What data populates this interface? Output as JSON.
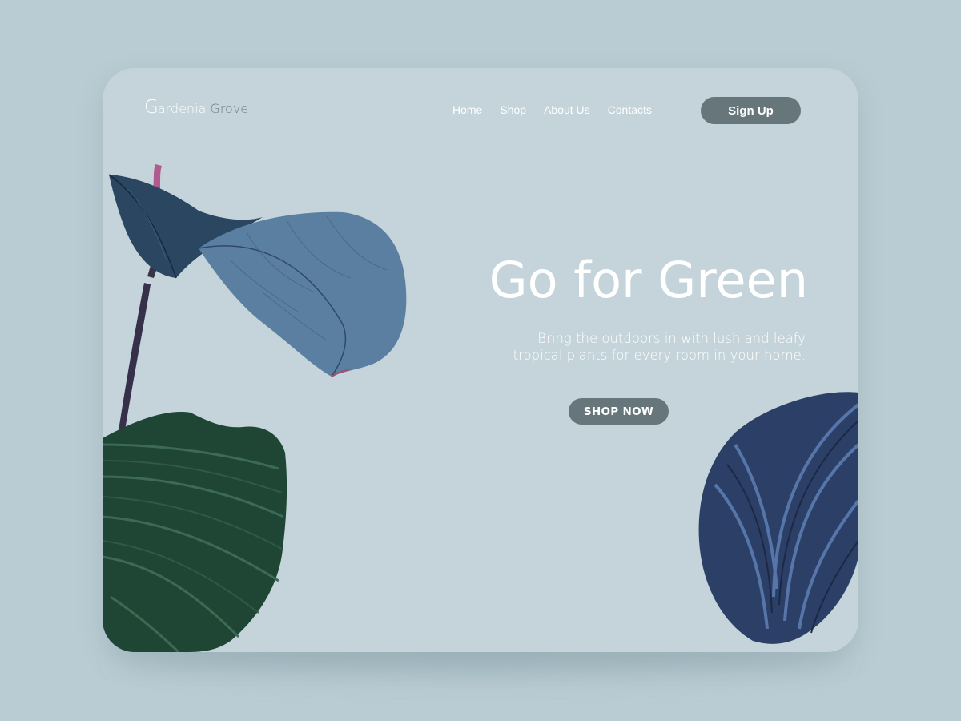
{
  "brand": {
    "initial": "G",
    "rest": "ardenia",
    "word2": "Grove"
  },
  "nav": {
    "items": [
      {
        "label": "Home"
      },
      {
        "label": "Shop"
      },
      {
        "label": "About Us"
      },
      {
        "label": "Contacts"
      }
    ]
  },
  "header": {
    "signup_label": "Sign Up"
  },
  "hero": {
    "title": "Go for Green",
    "subtitle": "Bring the outdoors in with lush and leafy tropical plants for every room in your home.",
    "cta_label": "SHOP NOW"
  },
  "colors": {
    "background": "#b9ccd3",
    "card": "#c4d4da",
    "button": "#66767a",
    "text": "#ffffff",
    "leaf_blue": "#4f7494",
    "leaf_dark_green": "#1f4534",
    "leaf_navy": "#2c3f66",
    "stem_pink": "#b05a8f"
  }
}
